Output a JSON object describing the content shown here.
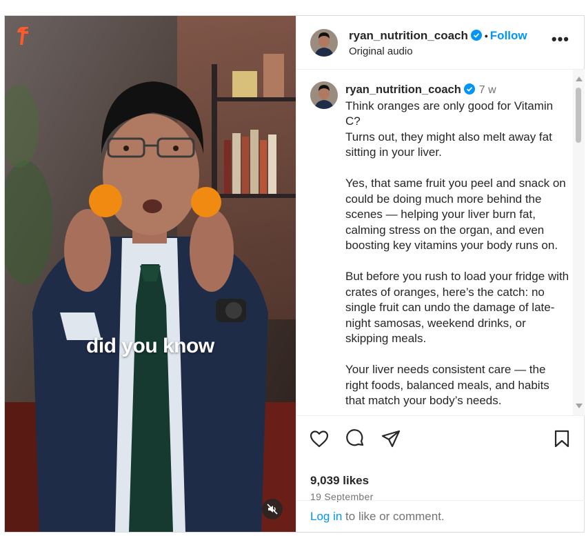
{
  "header": {
    "username": "ryan_nutrition_coach",
    "follow_label": "Follow",
    "separator": "•",
    "audio": "Original audio",
    "more": "•••"
  },
  "video": {
    "caption": "did you know",
    "muted": true
  },
  "comment": {
    "username": "ryan_nutrition_coach",
    "time": "7 w",
    "paragraphs": [
      "Think oranges are only good for Vitamin C?\nTurns out, they might also melt away fat sitting in your liver.",
      "Yes, that same fruit you peel and snack on could be doing much more behind the scenes — helping your liver burn fat, calming stress on the organ, and even boosting key vitamins your body runs on.",
      "But before you rush to load your fridge with crates of oranges, here’s the catch: no single fruit can undo the damage of late-night samosas, weekend drinks, or skipping meals.",
      "Your liver needs consistent care — the right foods, balanced meals, and habits that match your body’s needs."
    ]
  },
  "engagement": {
    "likes": "9,039 likes",
    "date": "19 September"
  },
  "login": {
    "link": "Log in",
    "rest": " to like or comment."
  },
  "colors": {
    "link_blue": "#0095f6",
    "verified_blue": "#0095f6",
    "text": "#262626",
    "muted_text": "#737373"
  }
}
